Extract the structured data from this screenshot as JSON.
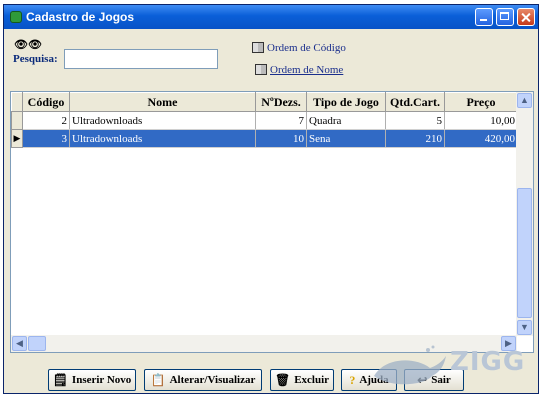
{
  "window": {
    "title": "Cadastro de Jogos"
  },
  "search": {
    "label": "Pesquisa:",
    "value": "",
    "placeholder": ""
  },
  "order": {
    "by_code": "Ordem de Código",
    "by_name": "Ordem de Nome"
  },
  "grid": {
    "columns": [
      "Código",
      "Nome",
      "NºDezs.",
      "Tipo de Jogo",
      "Qtd.Cart.",
      "Preço"
    ],
    "rows": [
      {
        "codigo": "2",
        "nome": "Ultradownloads",
        "dezenas": "7",
        "tipo": "Quadra",
        "qtd": "5",
        "preco": "10,00"
      },
      {
        "codigo": "3",
        "nome": "Ultradownloads",
        "dezenas": "10",
        "tipo": "Sena",
        "qtd": "210",
        "preco": "420,00"
      }
    ],
    "selected_row": 1
  },
  "buttons": {
    "insert": "Inserir Novo",
    "edit": "Alterar/Visualizar",
    "delete": "Excluir",
    "help": "Ajuda",
    "exit": "Sair"
  },
  "watermark": {
    "text": "ZIGG"
  },
  "icons": {
    "app": "app-icon",
    "binoculars": "binoculars-icon",
    "book": "book-icon",
    "insert": "new-record-icon",
    "edit": "edit-icon",
    "delete": "trash-icon",
    "help": "question-icon",
    "exit": "exit-icon"
  },
  "colors": {
    "title_bar": "#0a5fd8",
    "selection": "#316ac5",
    "link": "#1a2e8c"
  }
}
